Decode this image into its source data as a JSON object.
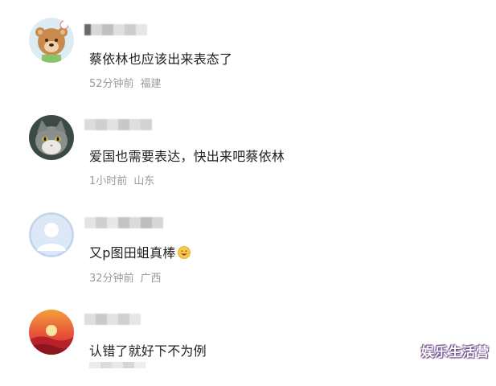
{
  "comments": [
    {
      "avatar": "bear-avatar-icon",
      "text": "蔡依林也应该出来表态了",
      "time": "52分钟前",
      "location": "福建"
    },
    {
      "avatar": "cat-avatar-icon",
      "text": "爱国也需要表达，快出来吧蔡依林",
      "time": "1小时前",
      "location": "山东"
    },
    {
      "avatar": "default-user-avatar-icon",
      "text": "又p图田蛆真棒",
      "time": "32分钟前",
      "location": "广西"
    },
    {
      "avatar": "sunset-avatar-icon",
      "text": "认错了就好下不为例",
      "time": "",
      "location": ""
    }
  ],
  "watermark": "娱乐生活营",
  "colors": {
    "text": "#222222",
    "meta": "#9a9a9a",
    "watermark_outline": "#6b4b8a"
  }
}
